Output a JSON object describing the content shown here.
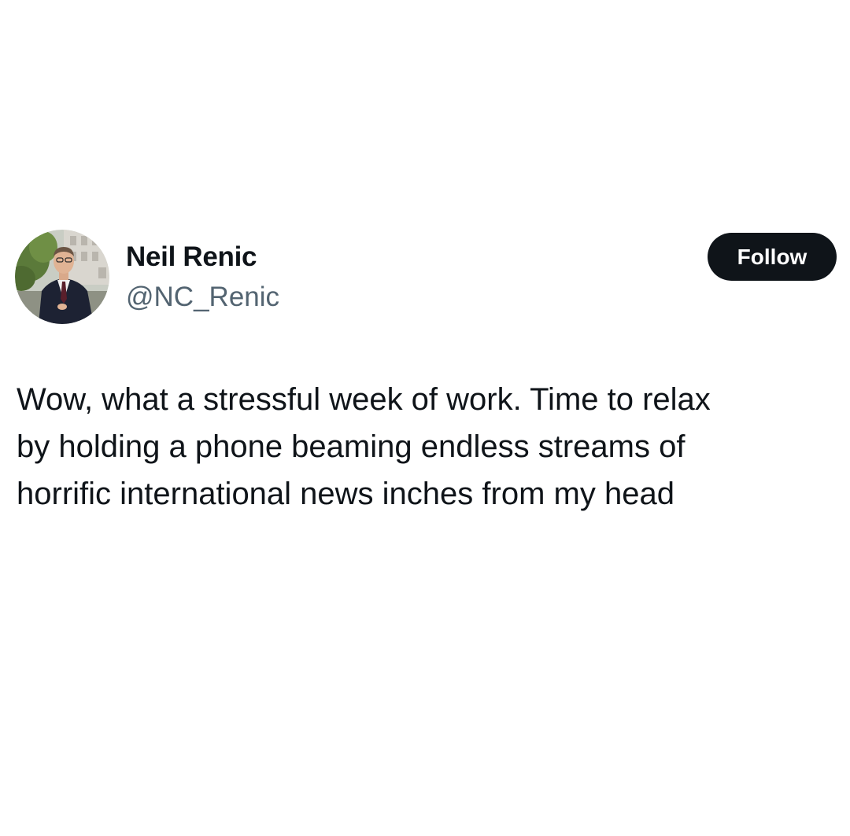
{
  "tweet": {
    "author": {
      "display_name": "Neil Renic",
      "handle": "@NC_Renic"
    },
    "follow_label": "Follow",
    "text_lines": [
      "Wow, what a stressful week of work. Time to relax",
      "by holding a phone beaming endless streams of",
      "horrific international news inches from my head"
    ]
  },
  "colors": {
    "background": "#ffffff",
    "text_primary": "#0f1419",
    "text_secondary": "#536471",
    "button_bg": "#0f1419",
    "button_text": "#ffffff"
  },
  "icons": {
    "avatar": "profile-photo"
  }
}
